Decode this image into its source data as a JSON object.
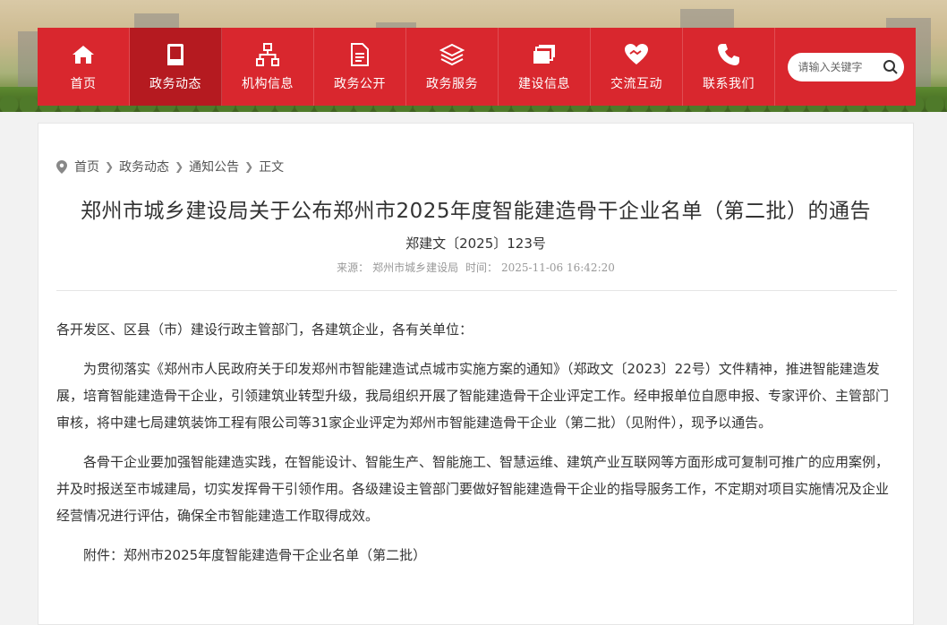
{
  "nav": {
    "items": [
      {
        "label": "首页",
        "icon": "home-icon"
      },
      {
        "label": "政务动态",
        "icon": "book-icon"
      },
      {
        "label": "机构信息",
        "icon": "org-chart-icon"
      },
      {
        "label": "政务公开",
        "icon": "document-icon"
      },
      {
        "label": "政务服务",
        "icon": "layers-icon"
      },
      {
        "label": "建设信息",
        "icon": "folders-icon"
      },
      {
        "label": "交流互动",
        "icon": "heart-hands-icon"
      },
      {
        "label": "联系我们",
        "icon": "phone-icon"
      }
    ],
    "active_index": 1,
    "search_placeholder": "请输入关键字"
  },
  "breadcrumb": {
    "items": [
      "首页",
      "政务动态",
      "通知公告",
      "正文"
    ]
  },
  "article": {
    "title": "郑州市城乡建设局关于公布郑州市2025年度智能建造骨干企业名单（第二批）的通告",
    "doc_number": "郑建文〔2025〕123号",
    "source_label": "来源：",
    "source": "郑州市城乡建设局",
    "time_label": "时间：",
    "time": "2025-11-06 16:42:20",
    "salutation": "各开发区、区县（市）建设行政主管部门，各建筑企业，各有关单位：",
    "paragraph1": "为贯彻落实《郑州市人民政府关于印发郑州市智能建造试点城市实施方案的通知》（郑政文〔2023〕22号）文件精神，推进智能建造发展，培育智能建造骨干企业，引领建筑业转型升级，我局组织开展了智能建造骨干企业评定工作。经申报单位自愿申报、专家评价、主管部门审核，将中建七局建筑装饰工程有限公司等31家企业评定为郑州市智能建造骨干企业（第二批）（见附件），现予以通告。",
    "paragraph2": "各骨干企业要加强智能建造实践，在智能设计、智能生产、智能施工、智慧运维、建筑产业互联网等方面形成可复制可推广的应用案例，并及时报送至市城建局，切实发挥骨干引领作用。各级建设主管部门要做好智能建造骨干企业的指导服务工作，不定期对项目实施情况及企业经营情况进行评估，确保全市智能建造工作取得成效。",
    "attachment": "附件：郑州市2025年度智能建造骨干企业名单（第二批）"
  },
  "colors": {
    "nav_red": "#d9272e",
    "nav_active": "#b51a20"
  }
}
